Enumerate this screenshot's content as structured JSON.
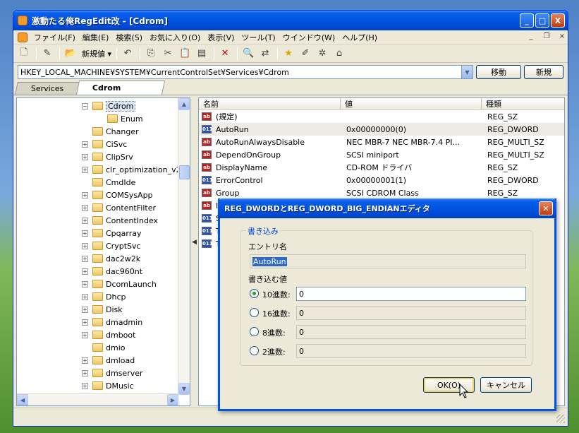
{
  "window": {
    "title": "激動たる俺RegEdit改 - [Cdrom]",
    "controls": {
      "minimize": "_",
      "maximize": "□",
      "close": "X"
    }
  },
  "menubar": {
    "items": [
      "ファイル(F)",
      "編集(E)",
      "検索(S)",
      "お気に入り(O)",
      "表示(V)",
      "ツール(T)",
      "ウインドウ(W)",
      "ヘルプ(H)"
    ],
    "mdi": {
      "minimize": "_",
      "restore": "❐",
      "close": "×"
    }
  },
  "toolbar": {
    "new_label": "新規値 ▾"
  },
  "address": {
    "path": "HKEY_LOCAL_MACHINE¥SYSTEM¥CurrentControlSet¥Services¥Cdrom",
    "go_label": "移動",
    "new_label": "新規"
  },
  "tabs": [
    {
      "label": "Services"
    },
    {
      "label": "Cdrom"
    }
  ],
  "tree": {
    "items": [
      "Cdrom",
      "Enum",
      "Changer",
      "CiSvc",
      "ClipSrv",
      "clr_optimization_v2.",
      "CmdIde",
      "COMSysApp",
      "ContentFilter",
      "ContentIndex",
      "Cpqarray",
      "CryptSvc",
      "dac2w2k",
      "dac960nt",
      "DcomLaunch",
      "Dhcp",
      "Disk",
      "dmadmin",
      "dmboot",
      "dmio",
      "dmload",
      "dmserver",
      "DMusic"
    ]
  },
  "list": {
    "headers": {
      "name": "名前",
      "value": "値",
      "type": "種類"
    },
    "rows": [
      {
        "name": "(規定)",
        "value": "",
        "type": "REG_SZ",
        "icon": "sz"
      },
      {
        "name": "AutoRun",
        "value": "0x00000000(0)",
        "type": "REG_DWORD",
        "icon": "dw"
      },
      {
        "name": "AutoRunAlwaysDisable",
        "value": "NEC    MBR-7    NEC    MBR-7.4  PI...",
        "type": "REG_MULTI_SZ",
        "icon": "sz"
      },
      {
        "name": "DependOnGroup",
        "value": "SCSI miniport",
        "type": "REG_MULTI_SZ",
        "icon": "sz"
      },
      {
        "name": "DisplayName",
        "value": "CD-ROM ドライバ",
        "type": "REG_SZ",
        "icon": "sz"
      },
      {
        "name": "ErrorControl",
        "value": "0x00000001(1)",
        "type": "REG_DWORD",
        "icon": "dw"
      },
      {
        "name": "Group",
        "value": "SCSI CDROM Class",
        "type": "REG_SZ",
        "icon": "sz"
      },
      {
        "name": "I",
        "value": "",
        "type": "",
        "icon": "sz"
      },
      {
        "name": "S",
        "value": "",
        "type": "",
        "icon": "dw"
      },
      {
        "name": "T",
        "value": "",
        "type": "",
        "icon": "dw"
      },
      {
        "name": "T",
        "value": "",
        "type": "",
        "icon": "dw"
      }
    ]
  },
  "dialog": {
    "title": "REG_DWORDとREG_DWORD_BIG_ENDIANエディタ",
    "group_label": "書き込み",
    "entry_label": "エントリ名",
    "entry_value": "AutoRun",
    "write_label": "書き込む値",
    "radix": [
      {
        "label": "10進数:",
        "value": "0",
        "selected": true
      },
      {
        "label": "16進数:",
        "value": "0",
        "selected": false
      },
      {
        "label": "8進数:",
        "value": "0",
        "selected": false
      },
      {
        "label": "2進数:",
        "value": "0",
        "selected": false
      }
    ],
    "ok_label": "OK(O)",
    "cancel_label": "キャンセル"
  }
}
